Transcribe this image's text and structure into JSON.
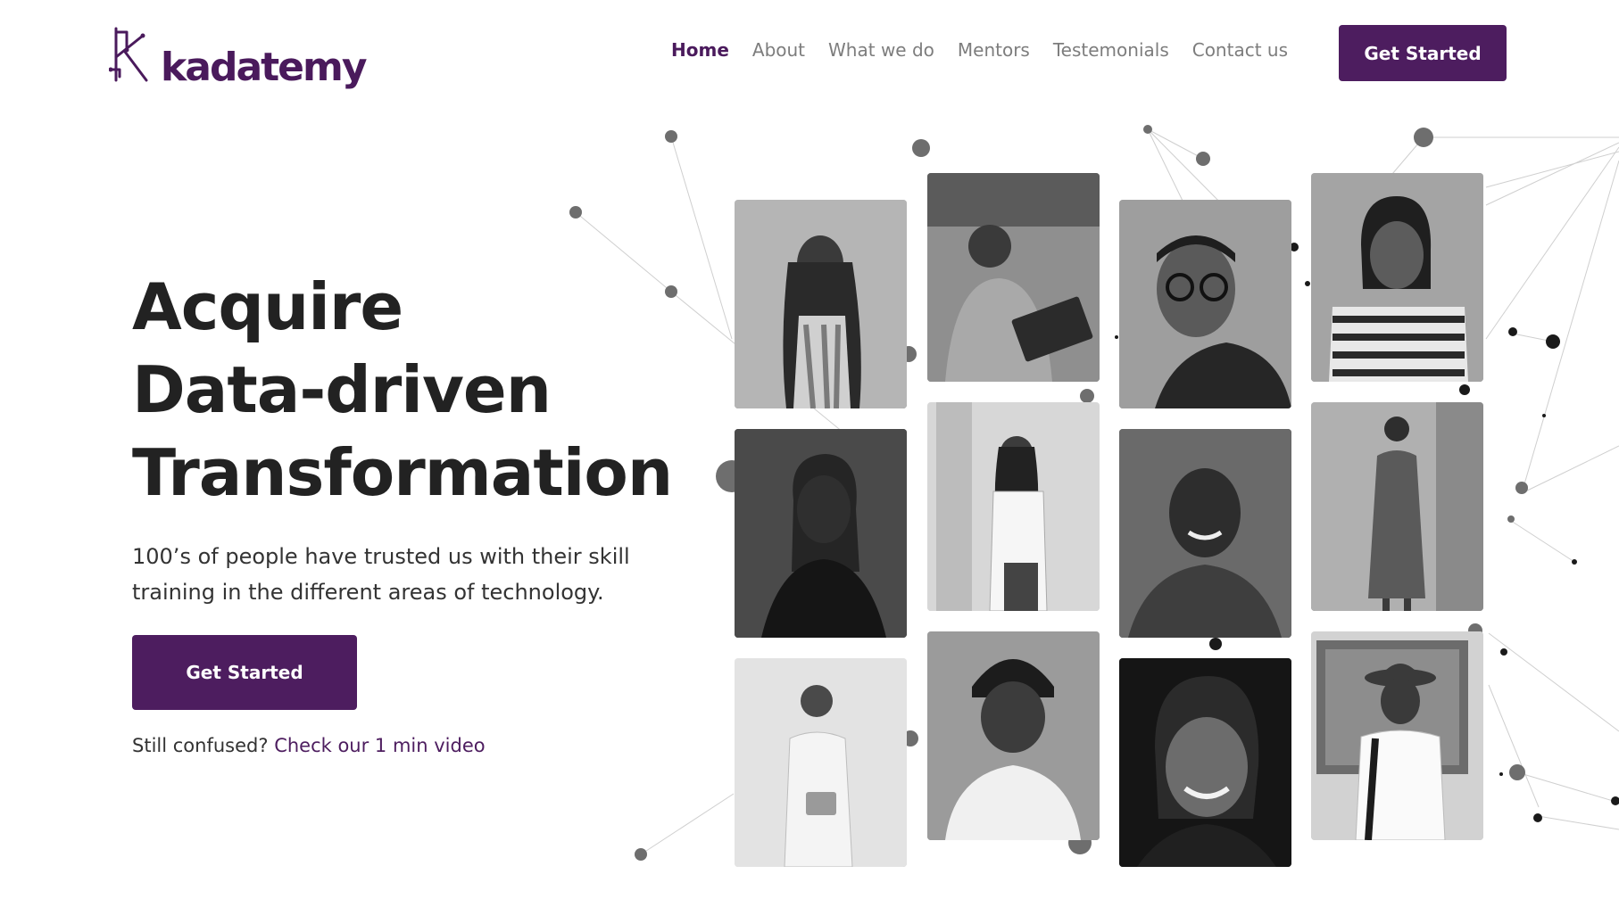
{
  "brand": {
    "name": "kadatemy",
    "color": "#4d1d5f"
  },
  "nav": {
    "items": [
      {
        "label": "Home",
        "active": true
      },
      {
        "label": "About"
      },
      {
        "label": "What we do"
      },
      {
        "label": "Mentors"
      },
      {
        "label": "Testemonials"
      },
      {
        "label": "Contact us"
      }
    ],
    "cta_label": "Get Started"
  },
  "hero": {
    "headline": [
      "Acquire",
      "Data-driven",
      "Transformation"
    ],
    "subtext": "100’s of people have trusted us with their skill training in the different areas of technology.",
    "cta_label": "Get Started",
    "video_prompt": "Still confused?",
    "video_link": "Check our 1 min video"
  },
  "gallery": {
    "photos": [
      {
        "name": "photo-woman-braids"
      },
      {
        "name": "photo-man-laptop"
      },
      {
        "name": "photo-man-glasses"
      },
      {
        "name": "photo-woman-striped-top"
      },
      {
        "name": "photo-woman-portrait"
      },
      {
        "name": "photo-woman-doorway"
      },
      {
        "name": "photo-young-man-smiling"
      },
      {
        "name": "photo-woman-dress"
      },
      {
        "name": "photo-woman-tablet"
      },
      {
        "name": "photo-man-beanie"
      },
      {
        "name": "photo-woman-smiling-dark"
      },
      {
        "name": "photo-man-hat"
      }
    ]
  }
}
